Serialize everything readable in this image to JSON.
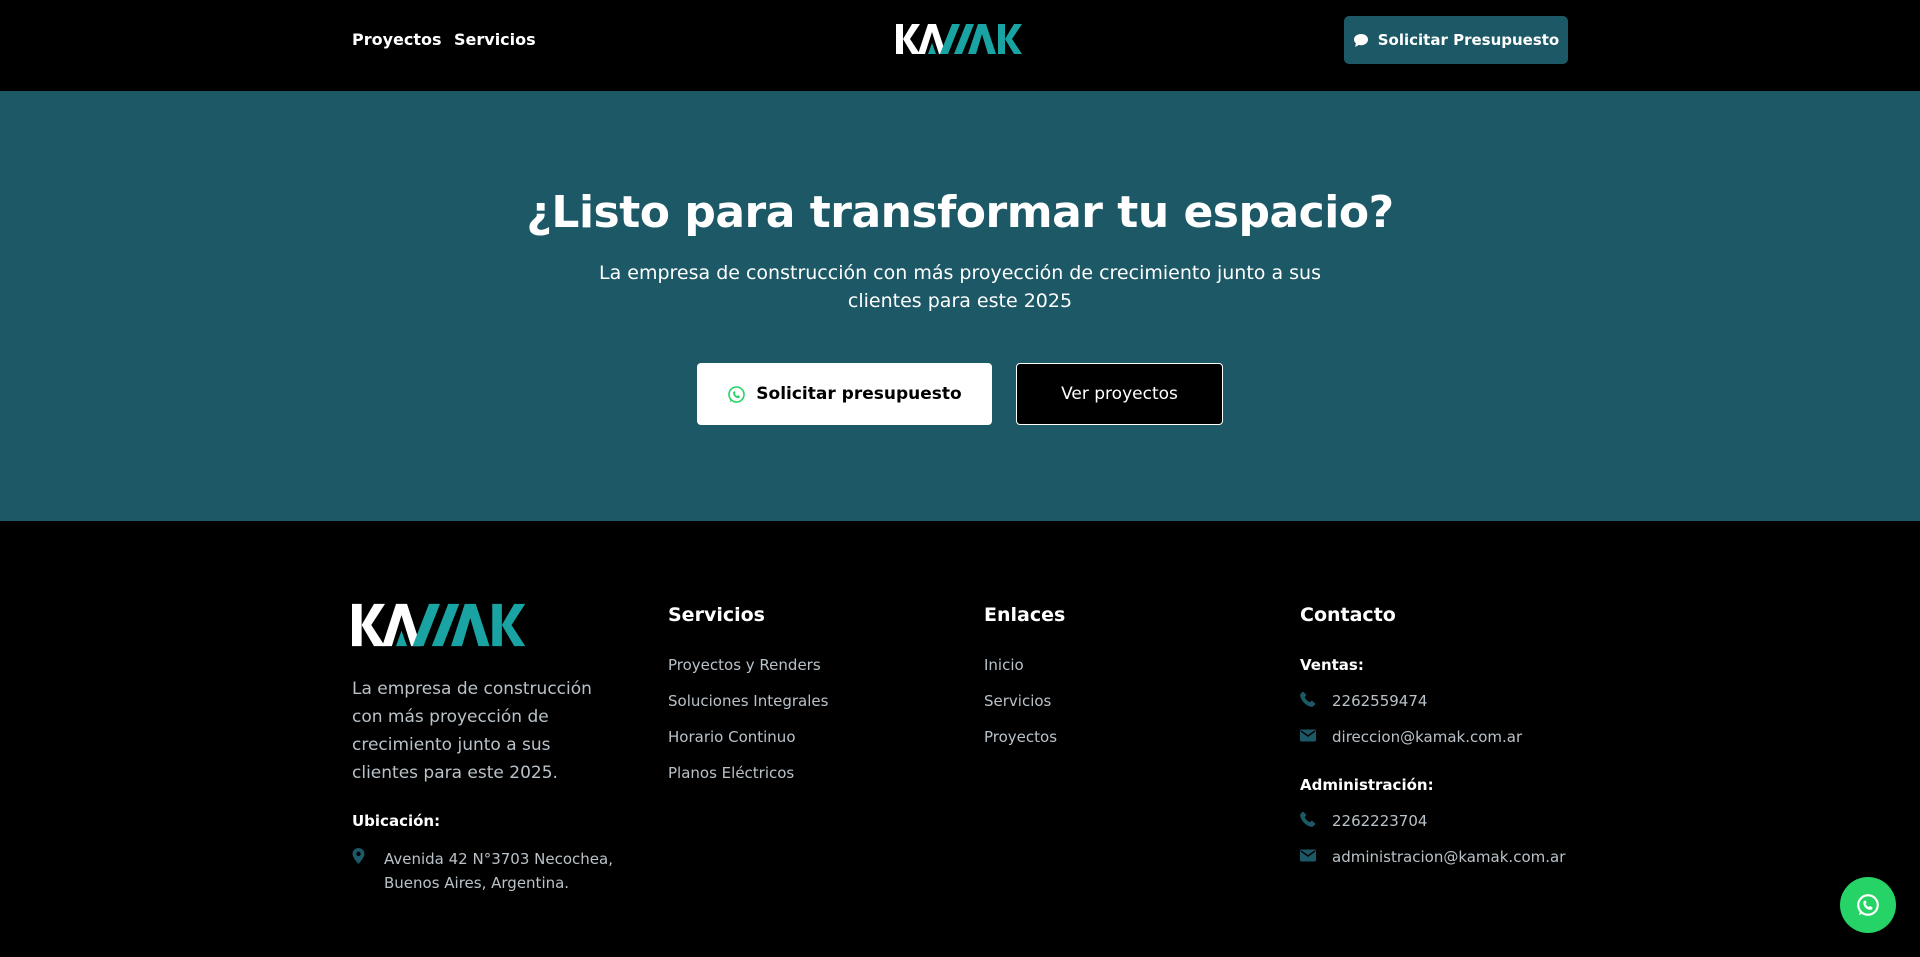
{
  "header": {
    "nav": [
      "Proyectos",
      "Servicios"
    ],
    "cta_label": "Solicitar Presupuesto",
    "logo_text": "KAMAK"
  },
  "hero": {
    "title": "¿Listo para transformar tu espacio?",
    "subtitle": "La empresa de construcción con más proyección de crecimiento junto a sus clientes para este 2025",
    "primary_button": "Solicitar presupuesto",
    "secondary_button": "Ver proyectos"
  },
  "footer": {
    "description": "La empresa de construcción con más proyección de crecimiento junto a sus clientes para este 2025.",
    "location_label": "Ubicación:",
    "address": "Avenida 42 N°3703 Necochea, Buenos Aires, Argentina.",
    "services": {
      "title": "Servicios",
      "items": [
        "Proyectos y Renders",
        "Soluciones Integrales",
        "Horario Continuo",
        "Planos Eléctricos"
      ]
    },
    "links": {
      "title": "Enlaces",
      "items": [
        "Inicio",
        "Servicios",
        "Proyectos"
      ]
    },
    "contact": {
      "title": "Contacto",
      "sales_label": "Ventas:",
      "sales_phone": "2262559474",
      "sales_email": "direccion@kamak.com.ar",
      "admin_label": "Administración:",
      "admin_phone": "2262223704",
      "admin_email": "administracion@kamak.com.ar"
    }
  },
  "colors": {
    "brand_teal": "#1c5866",
    "accent_teal": "#1aa3a3",
    "whatsapp": "#25d366"
  },
  "icons": [
    "chat-icon",
    "whatsapp-icon",
    "location-pin-icon",
    "phone-icon",
    "mail-icon"
  ]
}
